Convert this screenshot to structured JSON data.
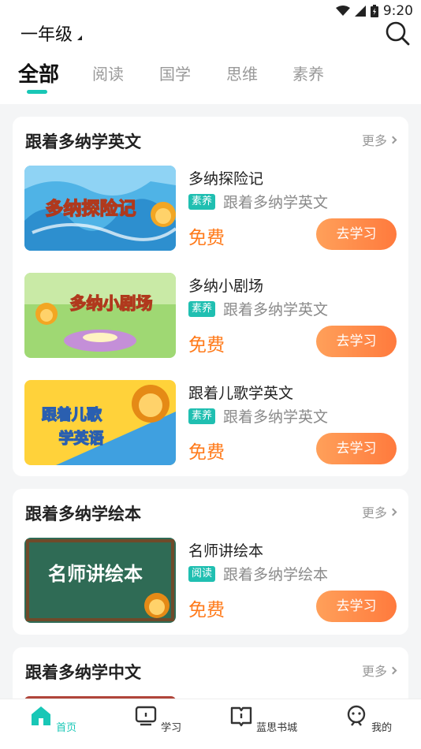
{
  "status_bar": {
    "time": "9:20"
  },
  "header": {
    "grade": "一年级"
  },
  "tabs": [
    {
      "label": "全部"
    },
    {
      "label": "阅读"
    },
    {
      "label": "国学"
    },
    {
      "label": "思维"
    },
    {
      "label": "素养"
    }
  ],
  "sections": [
    {
      "title": "跟着多纳学英文",
      "more": "更多",
      "items": [
        {
          "title": "多纳探险记",
          "thumb_text": "多纳探险记",
          "tag": "素养",
          "sub": "跟着多纳学英文",
          "price": "免费",
          "button": "去学习"
        },
        {
          "title": "多纳小剧场",
          "thumb_text": "多纳小剧场",
          "tag": "素养",
          "sub": "跟着多纳学英文",
          "price": "免费",
          "button": "去学习"
        },
        {
          "title": "跟着儿歌学英文",
          "thumb_text_1": "跟着儿歌",
          "thumb_text_2": "学英语",
          "tag": "素养",
          "sub": "跟着多纳学英文",
          "price": "免费",
          "button": "去学习"
        }
      ]
    },
    {
      "title": "跟着多纳学绘本",
      "more": "更多",
      "items": [
        {
          "title": "名师讲绘本",
          "thumb_text": "名师讲绘本",
          "tag": "阅读",
          "sub": "跟着多纳学绘本",
          "price": "免费",
          "button": "去学习"
        }
      ]
    },
    {
      "title": "跟着多纳学中文",
      "more": "更多"
    }
  ],
  "bottom_nav": [
    {
      "label": "首页",
      "icon": "home-icon"
    },
    {
      "label": "学习",
      "icon": "tv-icon"
    },
    {
      "label": "蓝思书城",
      "icon": "book-icon"
    },
    {
      "label": "我的",
      "icon": "profile-icon"
    }
  ],
  "colors": {
    "accent": "#18c7b6",
    "price": "#ff7a1a",
    "button": "#ff8a45",
    "tag": "#20bfb1"
  }
}
